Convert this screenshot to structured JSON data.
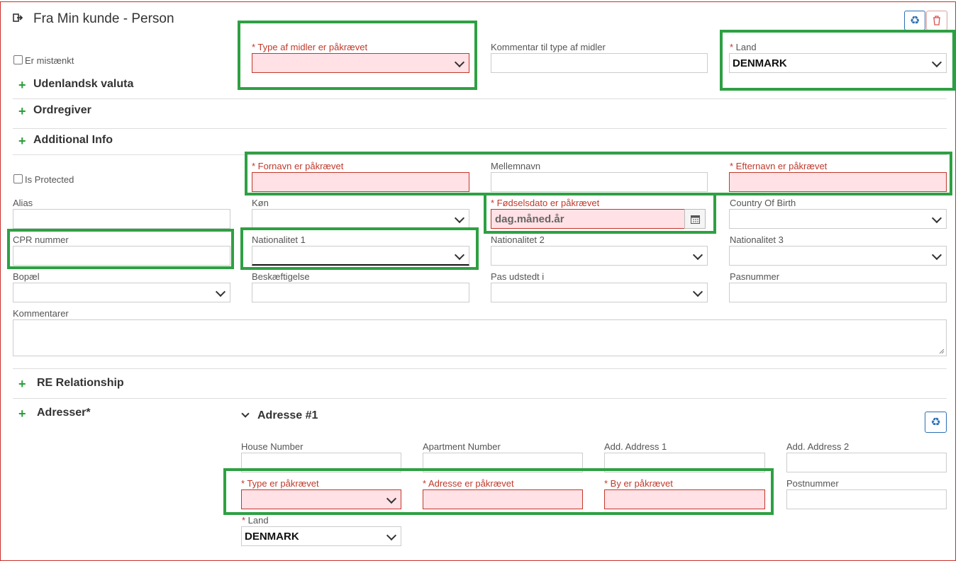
{
  "header": {
    "title": "Fra Min kunde - Person"
  },
  "checkboxes": {
    "suspect": "Er mistænkt",
    "protected": "Is Protected"
  },
  "fields": {
    "type_midler": "* Type af midler er påkrævet",
    "kommentar_type": "Kommentar til type af midler",
    "land_label": "Land",
    "land_value": "DENMARK",
    "fornavn": "* Fornavn er påkrævet",
    "mellemnavn": "Mellemnavn",
    "efternavn": "* Efternavn er påkrævet",
    "alias": "Alias",
    "kon": "Køn",
    "fodselsdato": "* Fødselsdato er påkrævet",
    "fodselsdato_placeholder": "dag.måned.år",
    "country_of_birth": "Country Of Birth",
    "cpr": "CPR nummer",
    "nat1": "Nationalitet 1",
    "nat2": "Nationalitet 2",
    "nat3": "Nationalitet 3",
    "bopael": "Bopæl",
    "beskaeftigelse": "Beskæftigelse",
    "pas_udstedt": "Pas udstedt i",
    "pasnummer": "Pasnummer",
    "kommentarer": "Kommentarer"
  },
  "sections": {
    "udenlandsk": "Udenlandsk valuta",
    "ordregiver": "Ordregiver",
    "additional": "Additional Info",
    "re_relationship": "RE Relationship",
    "adresser": "Adresser*"
  },
  "address": {
    "title": "Adresse #1",
    "house_number": "House Number",
    "apartment_number": "Apartment Number",
    "add1": "Add. Address 1",
    "add2": "Add. Address 2",
    "type": "* Type er påkrævet",
    "adresse": "* Adresse er påkrævet",
    "by": "* By er påkrævet",
    "postnummer": "Postnummer",
    "land_label": "Land",
    "land_value": "DENMARK"
  },
  "icons": [
    "sign-out-icon",
    "recycle-icon",
    "trash-icon",
    "calendar-icon",
    "plus-icon",
    "chevron-down-icon"
  ],
  "colors": {
    "highlight": "#2ea043",
    "error": "#c0392b",
    "error_bg": "#ffe1e6",
    "accent": "#2a6fb3",
    "plus": "#2a9d3a"
  }
}
